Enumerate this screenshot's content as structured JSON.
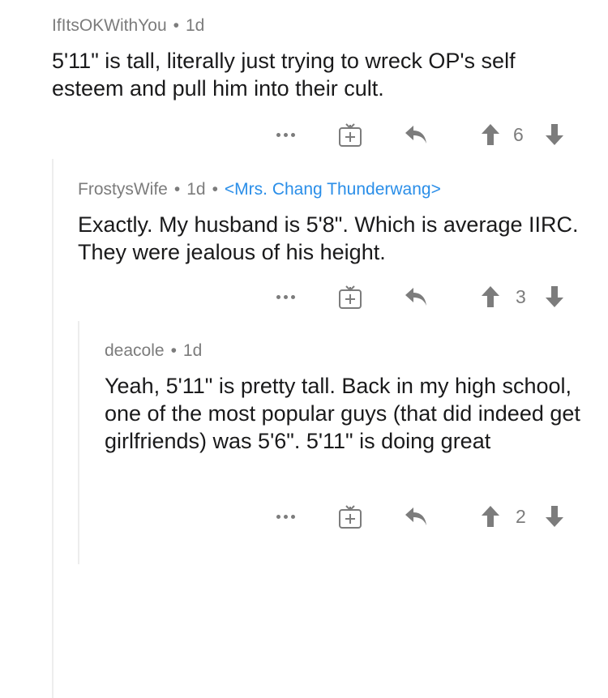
{
  "comments": [
    {
      "author": "IfItsOKWithYou",
      "age": "1d",
      "flair": "",
      "text": "5'11\" is tall, literally just trying to wreck OP's self esteem  and pull him into their cult.",
      "score": "6",
      "icons": [
        "more-options-icon",
        "gift-award-icon",
        "reply-icon",
        "upvote-icon",
        "downvote-icon"
      ]
    },
    {
      "author": "FrostysWife",
      "age": "1d",
      "flair": "<Mrs. Chang Thunderwang>",
      "text": "Exactly. My husband is 5'8\". Which is average IIRC. They were jealous of his height.",
      "score": "3",
      "icons": [
        "more-options-icon",
        "gift-award-icon",
        "reply-icon",
        "upvote-icon",
        "downvote-icon"
      ]
    },
    {
      "author": "deacole",
      "age": "1d",
      "flair": "",
      "text": "Yeah, 5'11\" is pretty tall. Back in my high school, one of the most popular guys (that did indeed get girlfriends) was 5'6\". 5'11\" is doing great",
      "score": "2",
      "icons": [
        "more-options-icon",
        "gift-award-icon",
        "reply-icon",
        "upvote-icon",
        "downvote-icon"
      ]
    }
  ],
  "colors": {
    "meta": "#7c7c7c",
    "flair": "#2a8ee8",
    "text": "#1a1a1b",
    "thread_line": "#ededed"
  }
}
